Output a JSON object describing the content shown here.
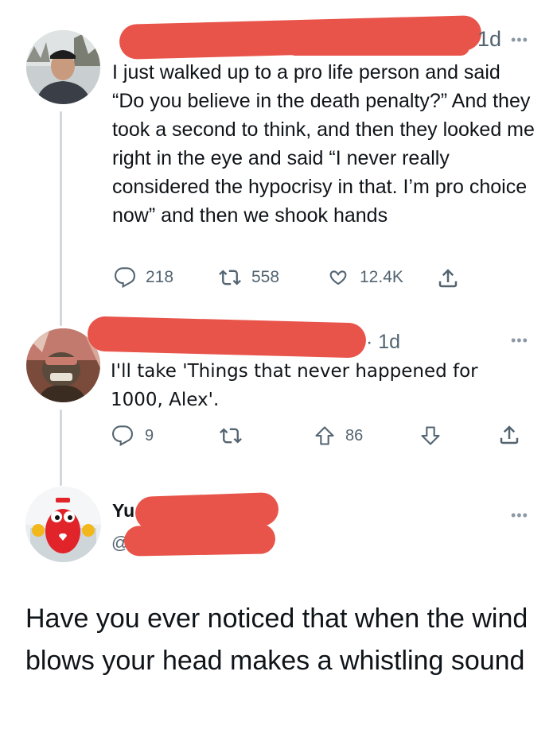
{
  "tweets": [
    {
      "time": "1d",
      "more": "•••",
      "text": "I just walked up to a pro life person and said “Do you believe in the death penalty?” And they took a second to think, and then they looked me right in the eye and said “I never really considered the hypocrisy in that. I’m pro choice now” and then we shook hands",
      "actions": {
        "replies": "218",
        "retweets": "558",
        "likes": "12.4K"
      },
      "icons": [
        "reply-icon",
        "retweet-icon",
        "like-icon",
        "share-icon"
      ]
    },
    {
      "time": "· 1d",
      "more": "•••",
      "text": "I'll take 'Things that never happened for 1000, Alex'.",
      "actions": {
        "replies": "9",
        "upvotes": "86"
      },
      "icons": [
        "reply-icon",
        "retweet-icon",
        "upvote-icon",
        "downvote-icon",
        "share-icon"
      ]
    },
    {
      "name_prefix": "Yu",
      "handle_prefix": "@",
      "more": "•••",
      "text": "Have you ever noticed that when the wind blows your head makes a whistling sound"
    }
  ],
  "colors": {
    "redaction": "#e8544a",
    "secondary_text": "#536471",
    "thread_line": "#cfd9de"
  }
}
